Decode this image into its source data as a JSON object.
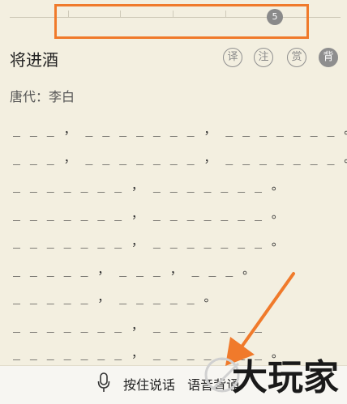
{
  "slider": {
    "value_label": "5"
  },
  "poem": {
    "title": "将进酒",
    "author_line": "唐代：李白",
    "lines": [
      "_ _ _ ， _ _ _ _ _ _ _ ， _ _ _ _ _ _ _ 。",
      "_ _ _ ， _ _ _ _ _ _ _ ， _ _ _ _ _ _ _ 。",
      "_ _ _ _ _ _ _ ， _ _ _ _ _ _ _ 。",
      "_ _ _ _ _ _ _ ， _ _ _ _ _ _ _ 。",
      "_ _ _ _ _ _ _ ， _ _ _ _ _ _ _ 。",
      "_ _ _ _ _ ， _ _ _ ， _ _ _ 。",
      "_ _ _ _ _ ， _ _ _ _ _ 。",
      "_ _ _ _ _ _ _ ， _ _ _ _ _ _ _",
      "_ _ _ _ _ _ _ ， _ _ _ _ _ _ _ 。"
    ]
  },
  "toolbar": {
    "translate_label": "译",
    "annotate_label": "注",
    "appreciate_label": "赏",
    "recite_label": "背"
  },
  "bottom": {
    "hold_to_speak_label": "按住说话",
    "voice_recite_label": "语音背诵"
  },
  "watermark": {
    "text": "大玩家"
  },
  "colors": {
    "highlight": "#f07a2b",
    "background": "#f3efe0"
  }
}
